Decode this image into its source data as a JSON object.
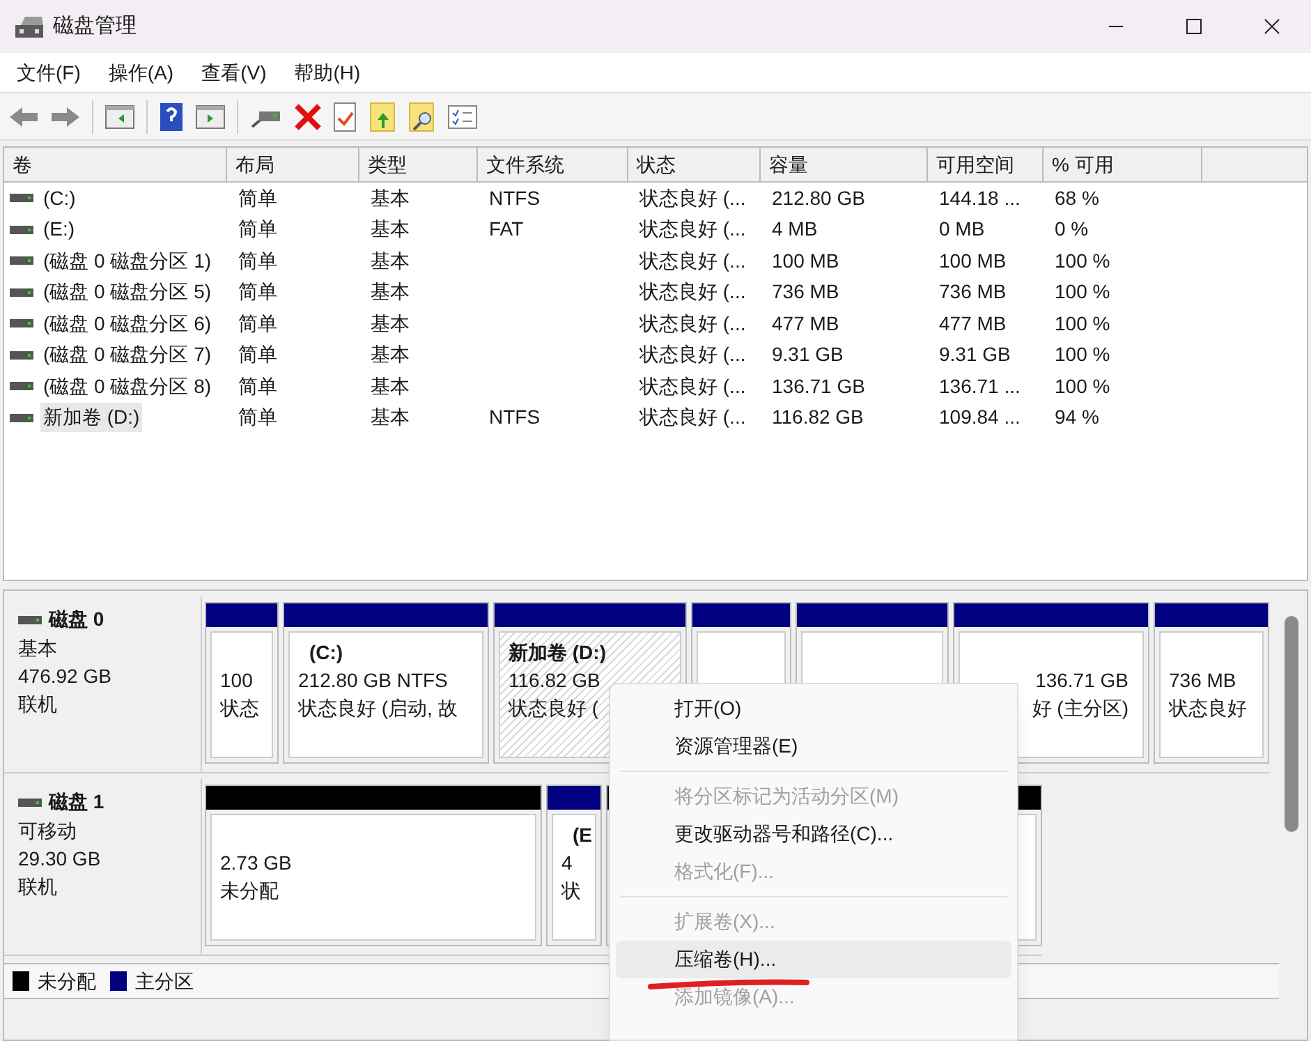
{
  "window": {
    "title": "磁盘管理"
  },
  "menu_bar": [
    "文件(F)",
    "操作(A)",
    "查看(V)",
    "帮助(H)"
  ],
  "volume_table": {
    "columns": [
      "卷",
      "布局",
      "类型",
      "文件系统",
      "状态",
      "容量",
      "可用空间",
      "% 可用"
    ],
    "rows": [
      {
        "selected": false,
        "cells": [
          "(C:)",
          "简单",
          "基本",
          "NTFS",
          "状态良好 (...",
          "212.80 GB",
          "144.18 ...",
          "68 %"
        ]
      },
      {
        "selected": false,
        "cells": [
          "(E:)",
          "简单",
          "基本",
          "FAT",
          "状态良好 (...",
          "4 MB",
          "0 MB",
          "0 %"
        ]
      },
      {
        "selected": false,
        "cells": [
          "(磁盘 0 磁盘分区 1)",
          "简单",
          "基本",
          "",
          "状态良好 (...",
          "100 MB",
          "100 MB",
          "100 %"
        ]
      },
      {
        "selected": false,
        "cells": [
          "(磁盘 0 磁盘分区 5)",
          "简单",
          "基本",
          "",
          "状态良好 (...",
          "736 MB",
          "736 MB",
          "100 %"
        ]
      },
      {
        "selected": false,
        "cells": [
          "(磁盘 0 磁盘分区 6)",
          "简单",
          "基本",
          "",
          "状态良好 (...",
          "477 MB",
          "477 MB",
          "100 %"
        ]
      },
      {
        "selected": false,
        "cells": [
          "(磁盘 0 磁盘分区 7)",
          "简单",
          "基本",
          "",
          "状态良好 (...",
          "9.31 GB",
          "9.31 GB",
          "100 %"
        ]
      },
      {
        "selected": false,
        "cells": [
          "(磁盘 0 磁盘分区 8)",
          "简单",
          "基本",
          "",
          "状态良好 (...",
          "136.71 GB",
          "136.71 ...",
          "100 %"
        ]
      },
      {
        "selected": true,
        "cells": [
          "新加卷 (D:)",
          "简单",
          "基本",
          "NTFS",
          "状态良好 (...",
          "116.82 GB",
          "109.84 ...",
          "94 %"
        ]
      }
    ]
  },
  "disks": [
    {
      "name": "磁盘 0",
      "type": "基本",
      "size": "476.92 GB",
      "status": "联机",
      "partitions": [
        {
          "kind": "primary",
          "selected": false,
          "lines": [
            "100",
            "状态"
          ]
        },
        {
          "kind": "primary",
          "selected": false,
          "title": "(C:)",
          "lines": [
            "212.80 GB NTFS",
            "状态良好 (启动, 故"
          ]
        },
        {
          "kind": "primary",
          "selected": true,
          "title": "新加卷 (D:)",
          "lines": [
            "116.82 GB",
            "状态良好 ("
          ]
        },
        {
          "kind": "primary",
          "selected": false
        },
        {
          "kind": "primary",
          "selected": false
        },
        {
          "kind": "primary",
          "selected": false,
          "lines": [
            "136.71 GB",
            "好 (主分区)"
          ]
        },
        {
          "kind": "primary",
          "selected": false,
          "lines": [
            "736 MB",
            "状态良好"
          ]
        }
      ]
    },
    {
      "name": "磁盘 1",
      "type": "可移动",
      "size": "29.30 GB",
      "status": "联机",
      "partitions": [
        {
          "kind": "unallocated",
          "selected": false,
          "lines": [
            "2.73 GB",
            "未分配"
          ]
        },
        {
          "kind": "primary",
          "selected": false,
          "title": "(E",
          "lines": [
            "4",
            "状"
          ]
        },
        {
          "kind": "unallocated",
          "selected": false
        }
      ]
    }
  ],
  "legend": [
    {
      "label": "未分配",
      "color": "#000000"
    },
    {
      "label": "主分区",
      "color": "#000080"
    }
  ],
  "context_menu": [
    {
      "kind": "item",
      "label": "打开(O)",
      "disabled": false,
      "highlighted": false
    },
    {
      "kind": "item",
      "label": "资源管理器(E)",
      "disabled": false,
      "highlighted": false
    },
    {
      "kind": "separator"
    },
    {
      "kind": "item",
      "label": "将分区标记为活动分区(M)",
      "disabled": true,
      "highlighted": false
    },
    {
      "kind": "item",
      "label": "更改驱动器号和路径(C)...",
      "disabled": false,
      "highlighted": false
    },
    {
      "kind": "item",
      "label": "格式化(F)...",
      "disabled": true,
      "highlighted": false
    },
    {
      "kind": "separator"
    },
    {
      "kind": "item",
      "label": "扩展卷(X)...",
      "disabled": true,
      "highlighted": false
    },
    {
      "kind": "item",
      "label": "压缩卷(H)...",
      "disabled": false,
      "highlighted": true
    },
    {
      "kind": "item",
      "label": "添加镜像(A)...",
      "disabled": true,
      "highlighted": false
    }
  ]
}
